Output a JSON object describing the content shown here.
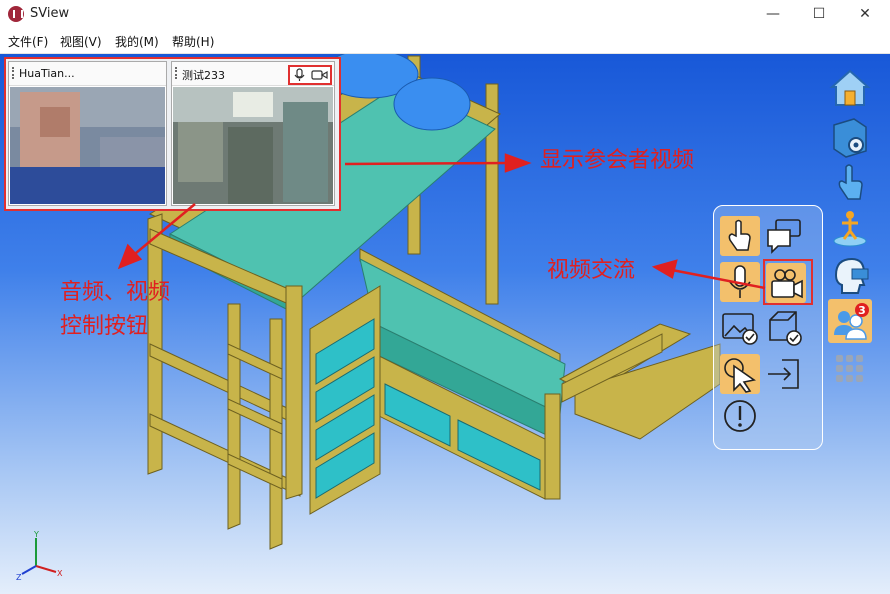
{
  "window": {
    "title": "SView",
    "minimize_glyph": "—",
    "maximize_glyph": "☐",
    "close_glyph": "✕"
  },
  "menu": {
    "items": [
      {
        "label": "文件(F)"
      },
      {
        "label": "视图(V)"
      },
      {
        "label": "我的(M)"
      },
      {
        "label": "帮助(H)"
      }
    ]
  },
  "video_panel": {
    "participants": [
      {
        "name": "HuaTian..."
      },
      {
        "name": "测试233",
        "controls": [
          "mic-icon",
          "camera-icon"
        ]
      }
    ]
  },
  "right_toolbar": {
    "icons": [
      "home-icon",
      "cube-settings-icon",
      "hand-pointer-icon",
      "walk-icon",
      "head-camera-icon",
      "participants-icon",
      "grid-icon"
    ],
    "participants_badge": "3"
  },
  "tools_panel": {
    "tools": [
      "hand-pointer-icon",
      "chat-icon",
      "mic-icon",
      "video-camera-icon",
      "image-check-icon",
      "cube-check-icon",
      "cursor-click-icon",
      "exit-icon",
      "alert-icon"
    ],
    "active": "video-camera-icon"
  },
  "annotations": {
    "show_participants_video": "显示参会者视频",
    "video_exchange": "视频交流",
    "av_controls_line1": "音频、视频",
    "av_controls_line2": "控制按钮"
  },
  "axis": {
    "x": "X",
    "y": "Y",
    "z": "Z"
  },
  "colors": {
    "annotation_red": "#e02020",
    "bed_frame": "#c8b44a",
    "mattress": "#4fc2b0",
    "viewport_top": "#1858d8"
  }
}
